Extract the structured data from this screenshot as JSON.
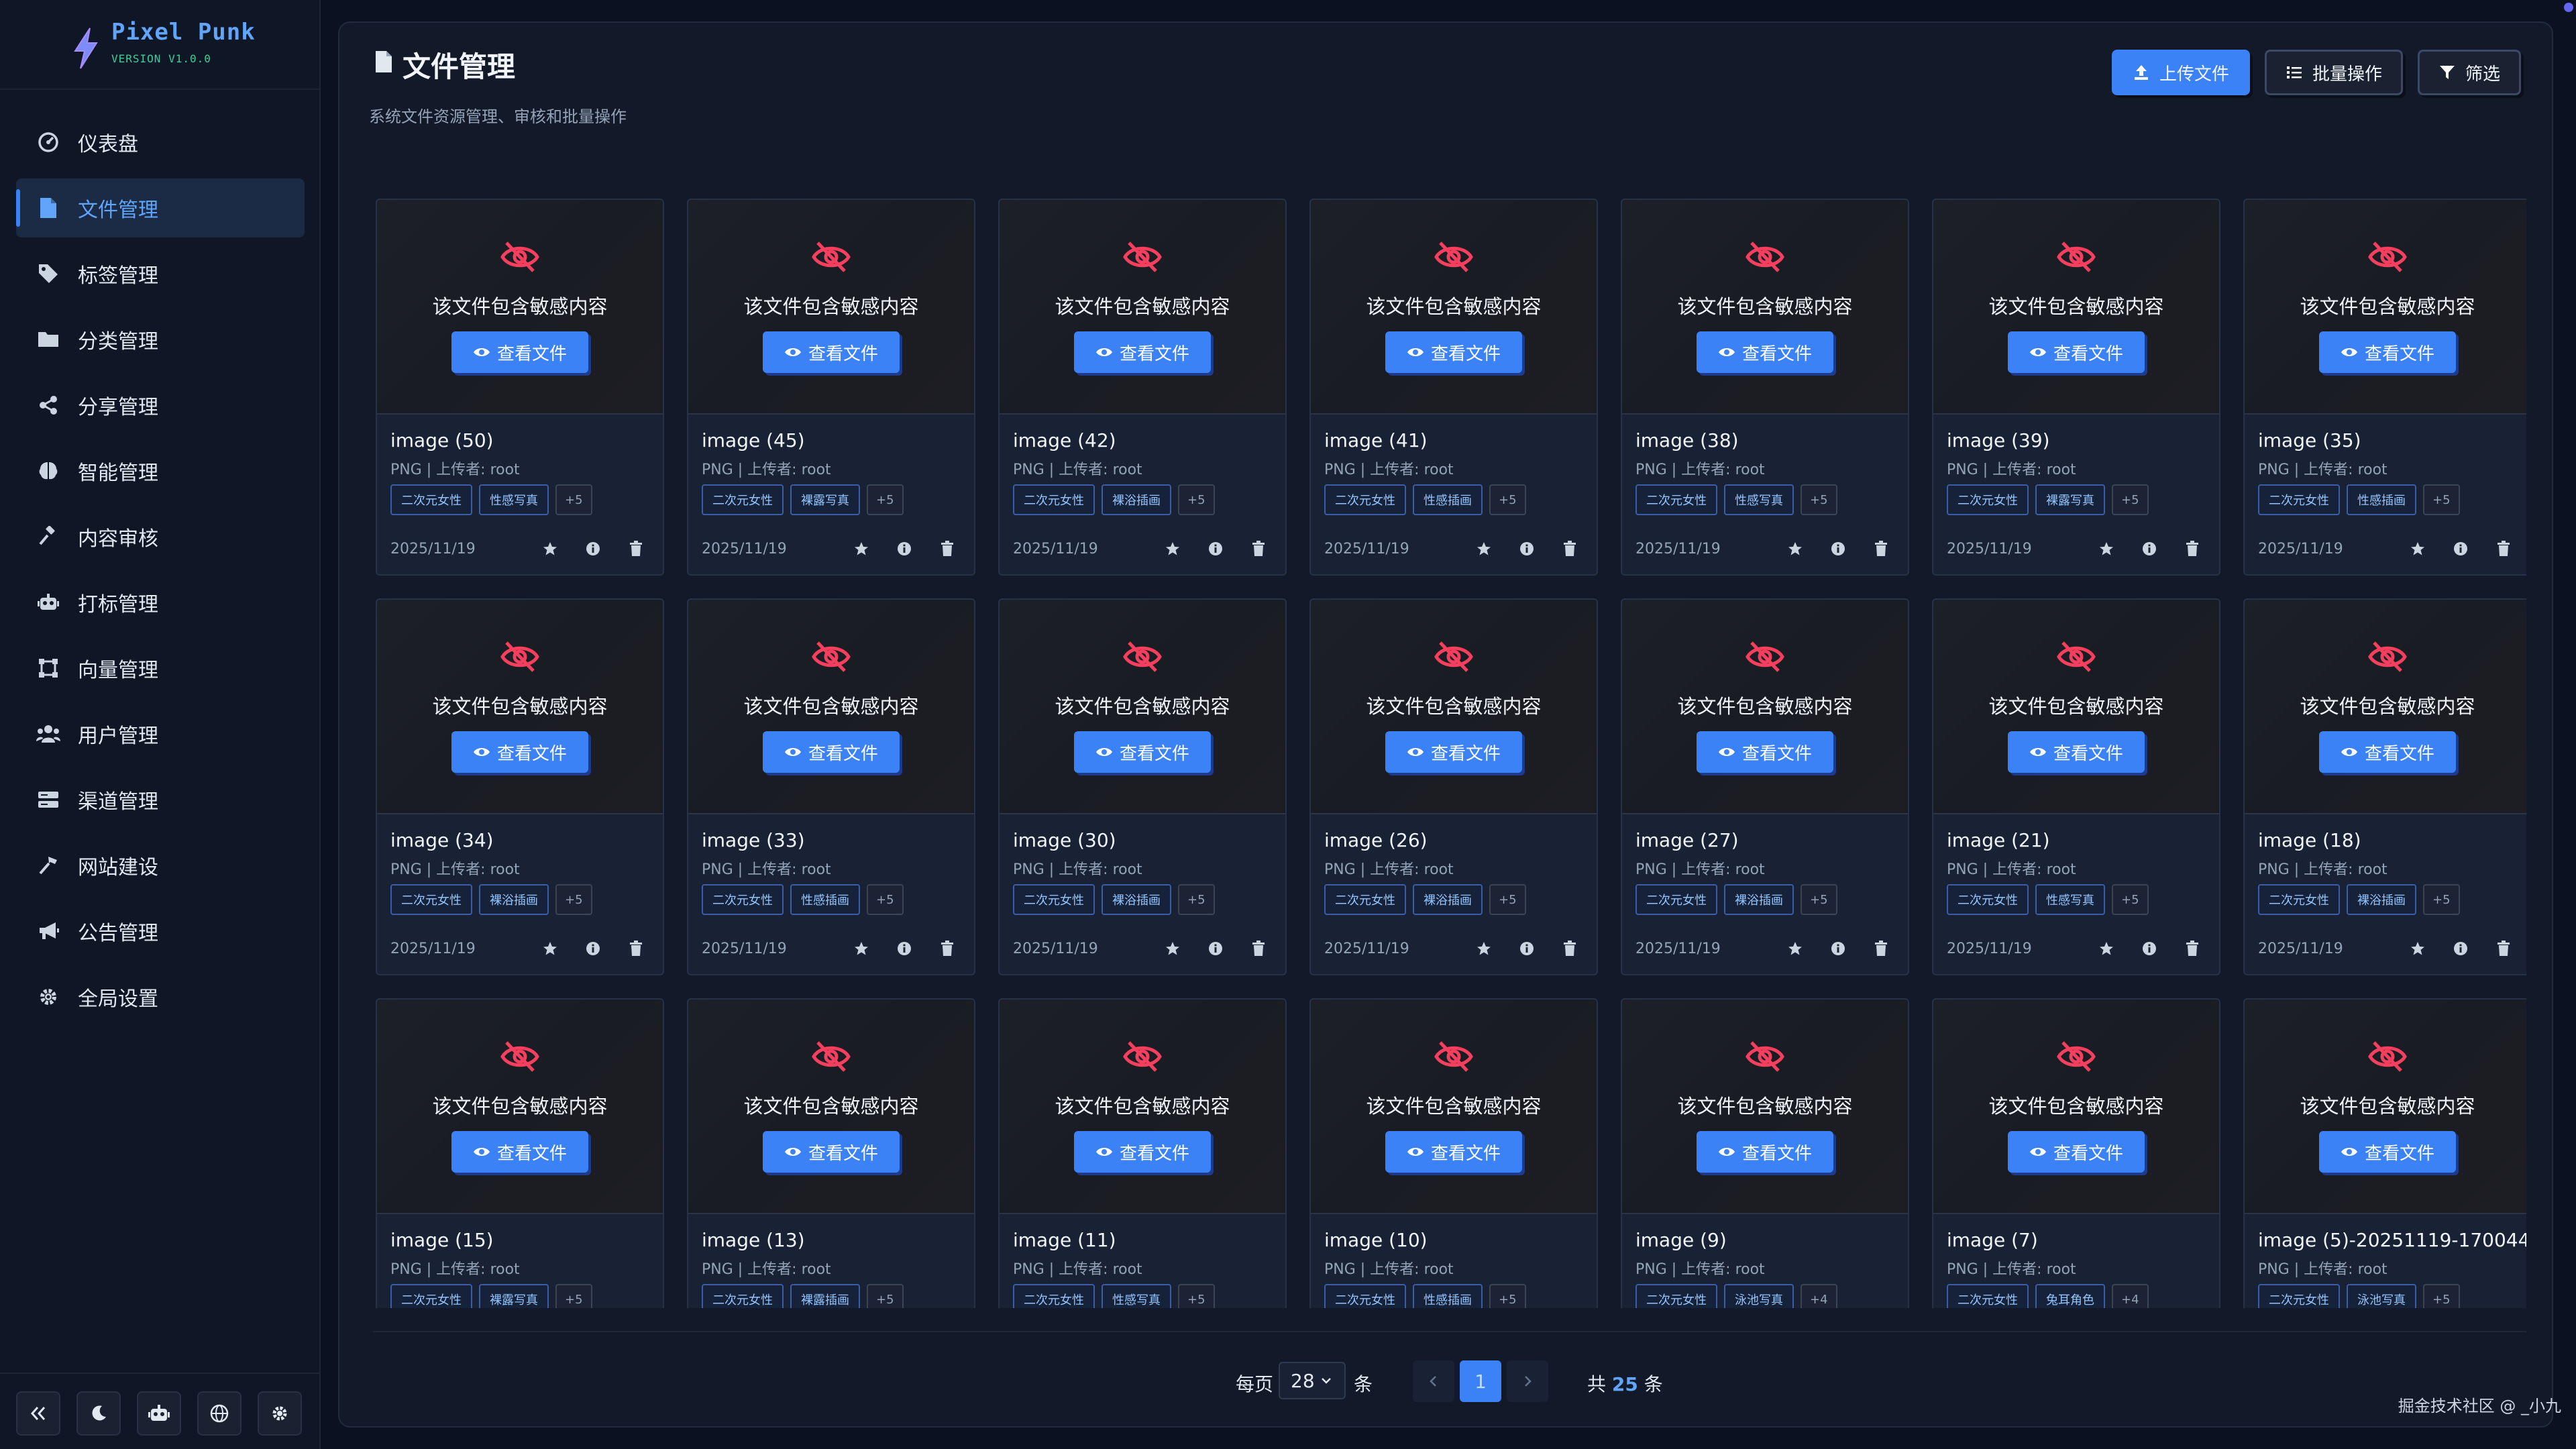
{
  "brand": {
    "name": "Pixel Punk",
    "version": "VERSION V1.0.0"
  },
  "sidebar": {
    "items": [
      {
        "label": "仪表盘",
        "icon": "dashboard-icon",
        "active": false
      },
      {
        "label": "文件管理",
        "icon": "file-icon",
        "active": true
      },
      {
        "label": "标签管理",
        "icon": "tag-icon",
        "active": false
      },
      {
        "label": "分类管理",
        "icon": "folder-icon",
        "active": false
      },
      {
        "label": "分享管理",
        "icon": "share-icon",
        "active": false
      },
      {
        "label": "智能管理",
        "icon": "brain-icon",
        "active": false
      },
      {
        "label": "内容审核",
        "icon": "gavel-icon",
        "active": false
      },
      {
        "label": "打标管理",
        "icon": "robot-icon",
        "active": false
      },
      {
        "label": "向量管理",
        "icon": "vector-icon",
        "active": false
      },
      {
        "label": "用户管理",
        "icon": "users-icon",
        "active": false
      },
      {
        "label": "渠道管理",
        "icon": "server-icon",
        "active": false
      },
      {
        "label": "网站建设",
        "icon": "hammer-icon",
        "active": false
      },
      {
        "label": "公告管理",
        "icon": "megaphone-icon",
        "active": false
      },
      {
        "label": "全局设置",
        "icon": "gear-icon",
        "active": false
      }
    ],
    "footer": [
      "collapse-icon",
      "moon-icon",
      "robot-icon",
      "globe-icon",
      "gear-icon"
    ]
  },
  "header": {
    "title": "文件管理",
    "subtitle": "系统文件资源管理、审核和批量操作",
    "upload_label": "上传文件",
    "batch_label": "批量操作",
    "filter_label": "筛选"
  },
  "card_text": {
    "sensitive": "该文件包含敏感内容",
    "view": "查看文件"
  },
  "files": [
    {
      "name": "image (50)",
      "meta": "PNG | 上传者: root",
      "tags": [
        "二次元女性",
        "性感写真"
      ],
      "more": "+5",
      "date": "2025/11/19"
    },
    {
      "name": "image (45)",
      "meta": "PNG | 上传者: root",
      "tags": [
        "二次元女性",
        "裸露写真"
      ],
      "more": "+5",
      "date": "2025/11/19"
    },
    {
      "name": "image (42)",
      "meta": "PNG | 上传者: root",
      "tags": [
        "二次元女性",
        "裸浴插画"
      ],
      "more": "+5",
      "date": "2025/11/19"
    },
    {
      "name": "image (41)",
      "meta": "PNG | 上传者: root",
      "tags": [
        "二次元女性",
        "性感插画"
      ],
      "more": "+5",
      "date": "2025/11/19"
    },
    {
      "name": "image (38)",
      "meta": "PNG | 上传者: root",
      "tags": [
        "二次元女性",
        "性感写真"
      ],
      "more": "+5",
      "date": "2025/11/19"
    },
    {
      "name": "image (39)",
      "meta": "PNG | 上传者: root",
      "tags": [
        "二次元女性",
        "裸露写真"
      ],
      "more": "+5",
      "date": "2025/11/19"
    },
    {
      "name": "image (35)",
      "meta": "PNG | 上传者: root",
      "tags": [
        "二次元女性",
        "性感插画"
      ],
      "more": "+5",
      "date": "2025/11/19"
    },
    {
      "name": "image (34)",
      "meta": "PNG | 上传者: root",
      "tags": [
        "二次元女性",
        "裸浴插画"
      ],
      "more": "+5",
      "date": "2025/11/19"
    },
    {
      "name": "image (33)",
      "meta": "PNG | 上传者: root",
      "tags": [
        "二次元女性",
        "性感插画"
      ],
      "more": "+5",
      "date": "2025/11/19"
    },
    {
      "name": "image (30)",
      "meta": "PNG | 上传者: root",
      "tags": [
        "二次元女性",
        "裸浴插画"
      ],
      "more": "+5",
      "date": "2025/11/19"
    },
    {
      "name": "image (26)",
      "meta": "PNG | 上传者: root",
      "tags": [
        "二次元女性",
        "裸浴插画"
      ],
      "more": "+5",
      "date": "2025/11/19"
    },
    {
      "name": "image (27)",
      "meta": "PNG | 上传者: root",
      "tags": [
        "二次元女性",
        "裸浴插画"
      ],
      "more": "+5",
      "date": "2025/11/19"
    },
    {
      "name": "image (21)",
      "meta": "PNG | 上传者: root",
      "tags": [
        "二次元女性",
        "性感写真"
      ],
      "more": "+5",
      "date": "2025/11/19"
    },
    {
      "name": "image (18)",
      "meta": "PNG | 上传者: root",
      "tags": [
        "二次元女性",
        "裸浴插画"
      ],
      "more": "+5",
      "date": "2025/11/19"
    },
    {
      "name": "image (15)",
      "meta": "PNG | 上传者: root",
      "tags": [
        "二次元女性",
        "裸露写真"
      ],
      "more": "+5",
      "date": ""
    },
    {
      "name": "image (13)",
      "meta": "PNG | 上传者: root",
      "tags": [
        "二次元女性",
        "裸露插画"
      ],
      "more": "+5",
      "date": ""
    },
    {
      "name": "image (11)",
      "meta": "PNG | 上传者: root",
      "tags": [
        "二次元女性",
        "性感写真"
      ],
      "more": "+5",
      "date": ""
    },
    {
      "name": "image (10)",
      "meta": "PNG | 上传者: root",
      "tags": [
        "二次元女性",
        "性感插画"
      ],
      "more": "+5",
      "date": ""
    },
    {
      "name": "image (9)",
      "meta": "PNG | 上传者: root",
      "tags": [
        "二次元女性",
        "泳池写真"
      ],
      "more": "+4",
      "date": ""
    },
    {
      "name": "image (7)",
      "meta": "PNG | 上传者: root",
      "tags": [
        "二次元女性",
        "兔耳角色"
      ],
      "more": "+4",
      "date": ""
    },
    {
      "name": "image (5)-20251119-170044",
      "meta": "PNG | 上传者: root",
      "tags": [
        "二次元女性",
        "泳池写真"
      ],
      "more": "+5",
      "date": ""
    }
  ],
  "pagination": {
    "per_page_label": "每页",
    "per_page_value": "28",
    "unit": "条",
    "current_page": "1",
    "total_prefix": "共",
    "total": "25",
    "total_suffix": "条"
  },
  "watermark": "掘金技术社区 @ _小九",
  "colors": {
    "accent": "#3b82f6",
    "danger": "#f43f5e",
    "bg": "#0b1120"
  }
}
